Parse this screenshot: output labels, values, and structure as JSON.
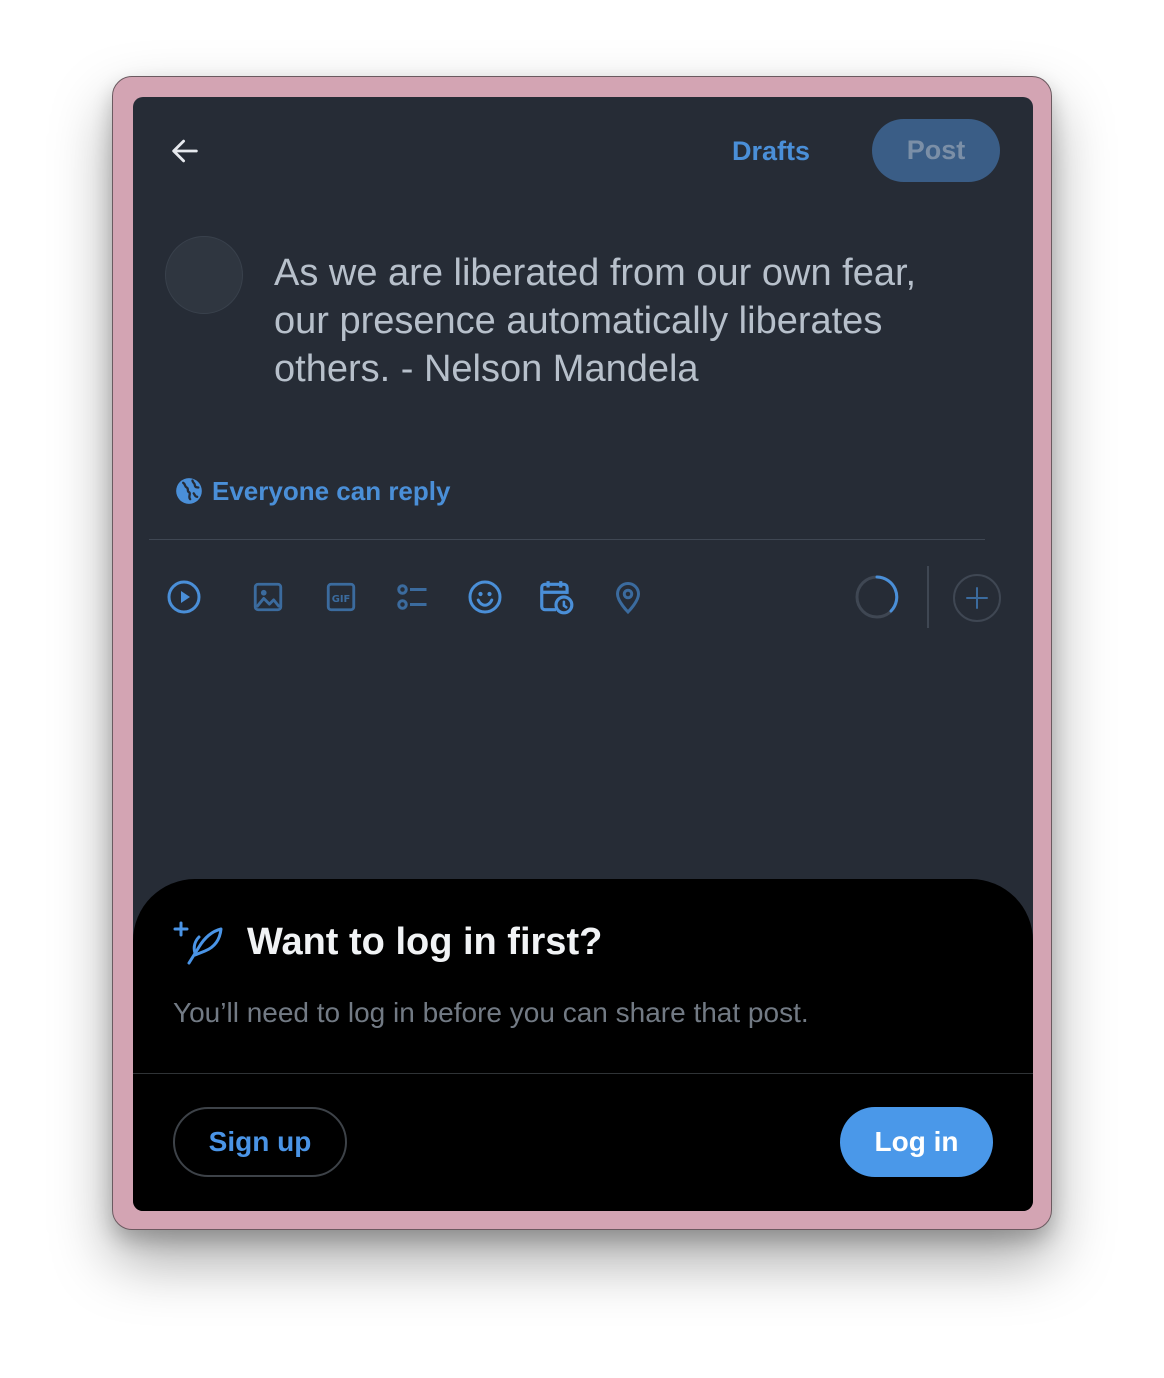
{
  "header": {
    "drafts_label": "Drafts",
    "post_label": "Post"
  },
  "composer": {
    "text": "As we are liberated from our own fear,\nour presence automatically liberates\nothers. - Nelson Mandela",
    "reply_setting": "Everyone can reply"
  },
  "toolbar": {
    "icons": [
      "video-play-icon",
      "image-icon",
      "gif-icon",
      "poll-icon",
      "emoji-icon",
      "schedule-icon",
      "location-icon",
      "progress-ring-icon",
      "add-post-icon"
    ]
  },
  "login_sheet": {
    "title": "Want to log in first?",
    "subtitle": "You’ll need to log in before you can share that post.",
    "signup_label": "Sign up",
    "login_label": "Log in"
  },
  "colors": {
    "accent": "#4a98e9",
    "background": "#262c36",
    "sheet_background": "#000000",
    "frame": "#d3a4b3"
  }
}
